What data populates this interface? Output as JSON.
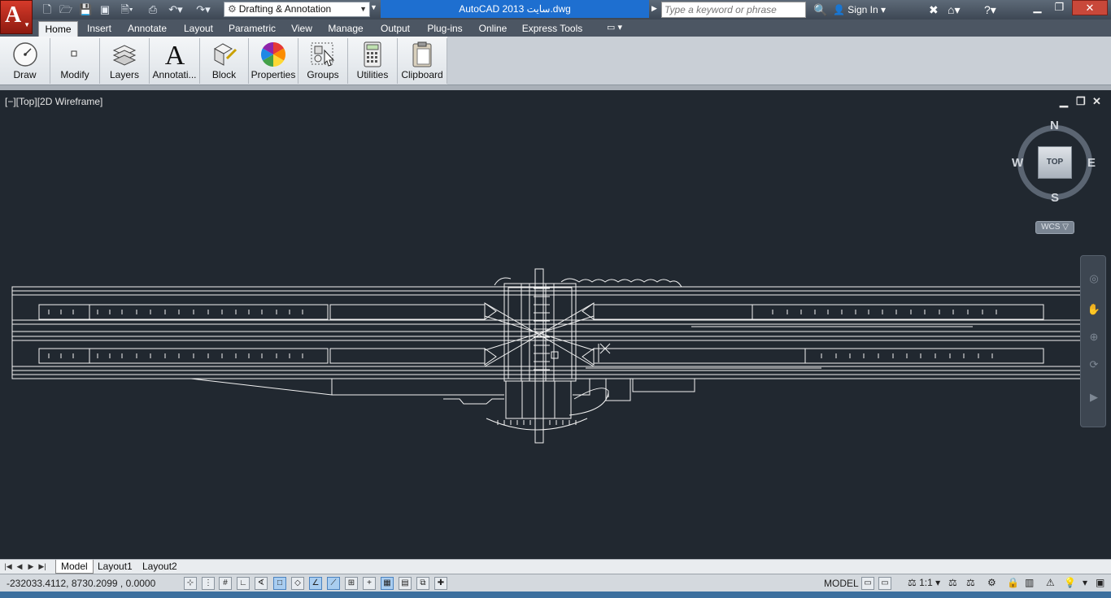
{
  "app": {
    "title": "AutoCAD 2013    سایت.dwg",
    "logo_letter": "A",
    "workspace": "Drafting & Annotation",
    "search_placeholder": "Type a keyword or phrase",
    "sign_in": "Sign In",
    "window_controls": [
      "minimize-icon",
      "restore-icon",
      "close-icon"
    ]
  },
  "quick_access": [
    "new-icon",
    "open-icon",
    "save-icon",
    "save-as-icon",
    "plot-preview-icon",
    "print-icon",
    "undo-icon",
    "redo-icon"
  ],
  "ribbon_tabs": [
    "Home",
    "Insert",
    "Annotate",
    "Layout",
    "Parametric",
    "View",
    "Manage",
    "Output",
    "Plug-ins",
    "Online",
    "Express Tools"
  ],
  "ribbon_active_tab": "Home",
  "ribbon_panels": [
    {
      "label": "Draw",
      "icon": "draw-icon"
    },
    {
      "label": "Modify",
      "icon": "modify-icon"
    },
    {
      "label": "Layers",
      "icon": "layers-icon"
    },
    {
      "label": "Annotati...",
      "icon": "annotation-icon"
    },
    {
      "label": "Block",
      "icon": "block-icon"
    },
    {
      "label": "Properties",
      "icon": "properties-icon"
    },
    {
      "label": "Groups",
      "icon": "groups-icon"
    },
    {
      "label": "Utilities",
      "icon": "utilities-icon"
    },
    {
      "label": "Clipboard",
      "icon": "clipboard-icon"
    }
  ],
  "viewport": {
    "label": "[−][Top][2D Wireframe]",
    "viewcube": {
      "face": "TOP",
      "north": "N",
      "south": "S",
      "east": "E",
      "west": "W"
    },
    "wcs": "WCS ▽"
  },
  "layout_tabs": [
    "Model",
    "Layout1",
    "Layout2"
  ],
  "layout_active": "Model",
  "status": {
    "coords": "-232033.4112, 8730.2099 , 0.0000",
    "model_label": "MODEL",
    "annotation_scale": "1:1"
  },
  "colors": {
    "viewport_bg": "#212830",
    "title_highlight": "#1e6fd0",
    "app_button": "#c0301f"
  }
}
